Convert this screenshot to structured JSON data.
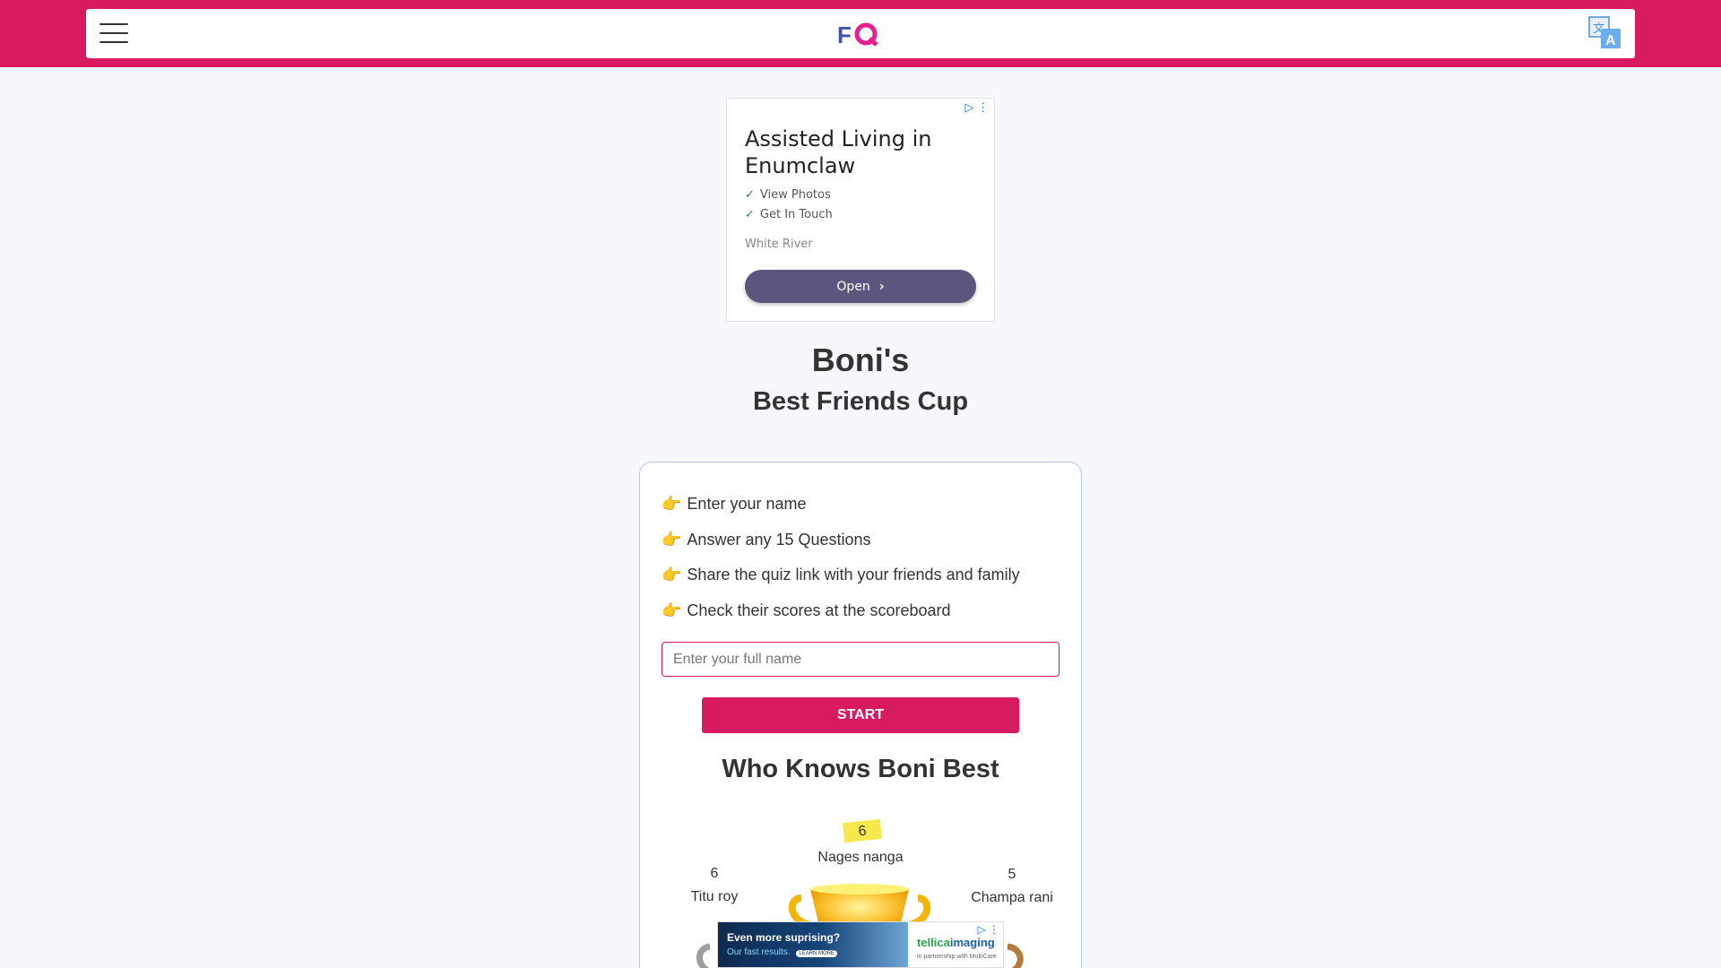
{
  "colors": {
    "brand": "#d81b60",
    "background": "#f6f8fb",
    "card_border": "#b7cde8",
    "ad_button": "#5b567e",
    "first_place_badge": "#f7e94d"
  },
  "header": {
    "menu_icon": "hamburger-menu-icon",
    "logo_text": "FQ",
    "translate_icon": "translate-icon"
  },
  "ad": {
    "title": "Assisted Living in Enumclaw",
    "features": [
      "View Photos",
      "Get In Touch"
    ],
    "source": "White River",
    "button_label": "Open",
    "adchoices_icon": "adchoices-icon"
  },
  "quiz": {
    "owner": "Boni's",
    "title": "Best Friends Cup"
  },
  "steps": [
    "Enter your name",
    "Answer any 15 Questions",
    "Share the quiz link with your friends and family",
    "Check their scores at the scoreboard"
  ],
  "step_icon": "👉",
  "form": {
    "name_placeholder": "Enter your full name",
    "start_label": "START"
  },
  "scoreboard": {
    "title": "Who Knows Boni Best",
    "first": {
      "score": "6",
      "name": "Nages nanga"
    },
    "second": {
      "score": "6",
      "name": "Titu roy"
    },
    "third": {
      "score": "5",
      "name": "Champa rani"
    }
  },
  "bottom_ad": {
    "headline": "Even more suprising?",
    "subline": "Our fast results.",
    "cta": "LEARN MORE",
    "brand_part1": "tellica",
    "brand_part2": "imaging",
    "partner": "in partnership with MultiCare"
  }
}
